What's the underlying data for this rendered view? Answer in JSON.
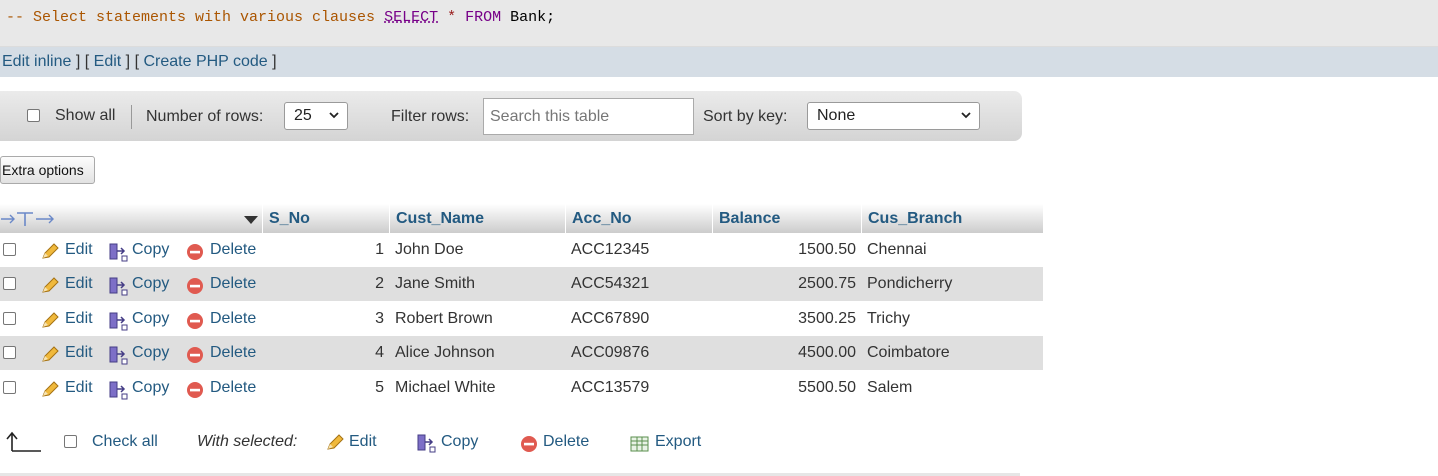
{
  "sql": {
    "comment": "-- Select statements with various clauses",
    "keyword_select": "SELECT",
    "star": "*",
    "keyword_from": "FROM",
    "table": "Bank;"
  },
  "edit_bar": {
    "edit_inline": "Edit inline",
    "edit": "Edit",
    "create_php": "Create PHP code",
    "open_bracket": "[",
    "close_bracket": "]"
  },
  "nav": {
    "show_all": "Show all",
    "number_of_rows_label": "Number of rows:",
    "rows_value": "25",
    "filter_rows_label": "Filter rows:",
    "search_placeholder": "Search this table",
    "sort_by_key_label": "Sort by key:",
    "sort_value": "None"
  },
  "extra_options": "Extra options",
  "table": {
    "columns": [
      "S_No",
      "Cust_Name",
      "Acc_No",
      "Balance",
      "Cus_Branch"
    ],
    "actions": {
      "edit": "Edit",
      "copy": "Copy",
      "delete": "Delete"
    },
    "rows": [
      {
        "s_no": "1",
        "name": "John Doe",
        "acc": "ACC12345",
        "balance": "1500.50",
        "branch": "Chennai"
      },
      {
        "s_no": "2",
        "name": "Jane Smith",
        "acc": "ACC54321",
        "balance": "2500.75",
        "branch": "Pondicherry"
      },
      {
        "s_no": "3",
        "name": "Robert Brown",
        "acc": "ACC67890",
        "balance": "3500.25",
        "branch": "Trichy"
      },
      {
        "s_no": "4",
        "name": "Alice Johnson",
        "acc": "ACC09876",
        "balance": "4500.00",
        "branch": "Coimbatore"
      },
      {
        "s_no": "5",
        "name": "Michael White",
        "acc": "ACC13579",
        "balance": "5500.50",
        "branch": "Salem"
      }
    ]
  },
  "footer": {
    "check_all": "Check all",
    "with_selected": "With selected:",
    "edit": "Edit",
    "copy": "Copy",
    "delete": "Delete",
    "export": "Export"
  },
  "colors": {
    "link": "#235a81",
    "sql_background": "#e8e8e8",
    "edit_bar_background": "#d5dde5",
    "alt_row": "#dfdfdf"
  },
  "icons": [
    "pencil-icon",
    "copy-icon",
    "delete-icon",
    "export-icon",
    "arrow-up-icon",
    "column-resize-icon",
    "sort-desc-icon",
    "chevron-down-icon"
  ]
}
